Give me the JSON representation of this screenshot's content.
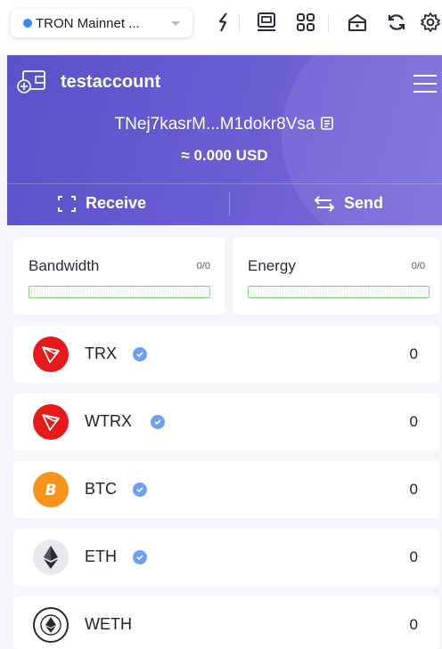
{
  "network": {
    "label": "TRON Mainnet ...",
    "dot_color": "#2f8bf5"
  },
  "toolbar_icons": [
    "energy-icon",
    "ledger-icon",
    "grid-icon",
    "lock-icon",
    "refresh-icon",
    "settings-icon"
  ],
  "account": {
    "name": "testaccount",
    "address": "TNej7kasrM...M1dokr8Vsa",
    "balance": "≈ 0.000 USD"
  },
  "actions": {
    "receive_label": "Receive",
    "send_label": "Send"
  },
  "resources": [
    {
      "name": "Bandwidth",
      "value": "0/0",
      "fraction": 0
    },
    {
      "name": "Energy",
      "value": "0/0",
      "fraction": 0
    }
  ],
  "tokens": [
    {
      "symbol": "TRX",
      "balance": "0",
      "verified": true,
      "icon": "trx-logo-icon",
      "color": "#e51b1b"
    },
    {
      "symbol": "WTRX",
      "balance": "0",
      "verified": true,
      "icon": "wtrx-logo-icon",
      "color": "#e51b1b"
    },
    {
      "symbol": "BTC",
      "balance": "0",
      "verified": true,
      "icon": "btc-logo-icon",
      "color": "#f7931a"
    },
    {
      "symbol": "ETH",
      "balance": "0",
      "verified": true,
      "icon": "eth-logo-icon",
      "color": "#e8e9ee"
    },
    {
      "symbol": "WETH",
      "balance": "0",
      "verified": false,
      "icon": "weth-logo-icon",
      "color": "#ffffff"
    }
  ],
  "colors": {
    "header": "#5f56cc",
    "verified": "#6e9ff0",
    "bar_border": "#7fd47f"
  }
}
